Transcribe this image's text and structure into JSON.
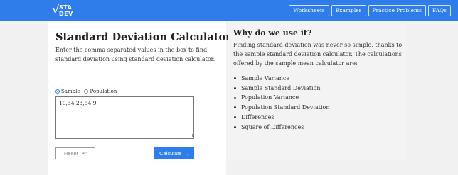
{
  "header": {
    "logo": {
      "line1": "STA",
      "line2": "DEV"
    },
    "nav": [
      "Worksheets",
      "Examples",
      "Practice Problems",
      "FAQs"
    ]
  },
  "calculator": {
    "title": "Standard Deviation Calculator",
    "description": "Enter the comma separated values in the box to find standard deviation using standard deviation calculator.",
    "radio_options": [
      "Sample",
      "Population"
    ],
    "selected": "Sample",
    "input_value": "10,34,23,54,9",
    "reset_label": "Reset",
    "calculate_label": "Calculate"
  },
  "info": {
    "title": "Why do we use it?",
    "text": "Finding standard deviation was never so simple, thanks to the sample standard deviation calculator. The calculations offered by the sample mean calculator are:",
    "items": [
      "Sample Variance",
      "Sample Standard Deviation",
      "Population Variance",
      "Population Standard Deviation",
      "Differences",
      "Square of Differences"
    ]
  },
  "colors": {
    "accent": "#2e7dea"
  }
}
